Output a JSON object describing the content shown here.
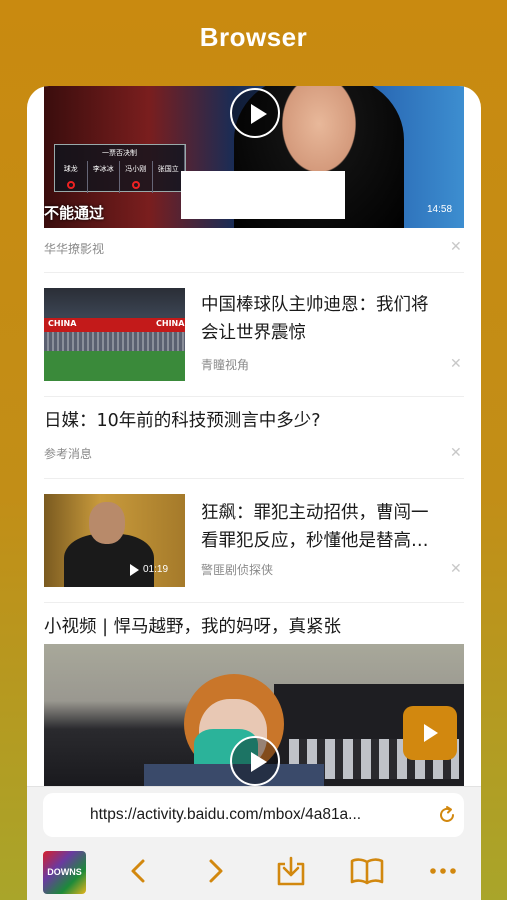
{
  "app": {
    "title": "Browser"
  },
  "feed": {
    "video1": {
      "overlay_text": "不能通过",
      "board_names": [
        "球龙",
        "李冰冰",
        "冯小刚",
        "张国立"
      ],
      "board_header": "一票否决制",
      "duration": "14:58",
      "source": "华华撩影视"
    },
    "article1": {
      "headline": "中国棒球队主帅迪恩：我们将会让世界震惊",
      "headline_line1": "中国棒球队主帅迪恩：我们将",
      "headline_line2": "会让世界震惊",
      "banner_left": "CHINA",
      "banner_right": "CHINA",
      "source": "青瞳视角"
    },
    "article2": {
      "headline": "日媒：10年前的科技预测言中多少?",
      "source": "参考消息"
    },
    "article3": {
      "headline_line1": "狂飙：罪犯主动招供，曹闯一",
      "headline_line2": "看罪犯反应，秒懂他是替高…",
      "duration": "01:19",
      "source": "警匪剧侦探侠"
    },
    "video2": {
      "headline": "小视频 | 悍马越野，我的妈呀，真紧张"
    }
  },
  "address_bar": {
    "url": "https://activity.baidu.com/mbox/4a81a..."
  },
  "toolbar": {
    "logo_text": "DOWNS",
    "accent_color": "#d2880f"
  }
}
